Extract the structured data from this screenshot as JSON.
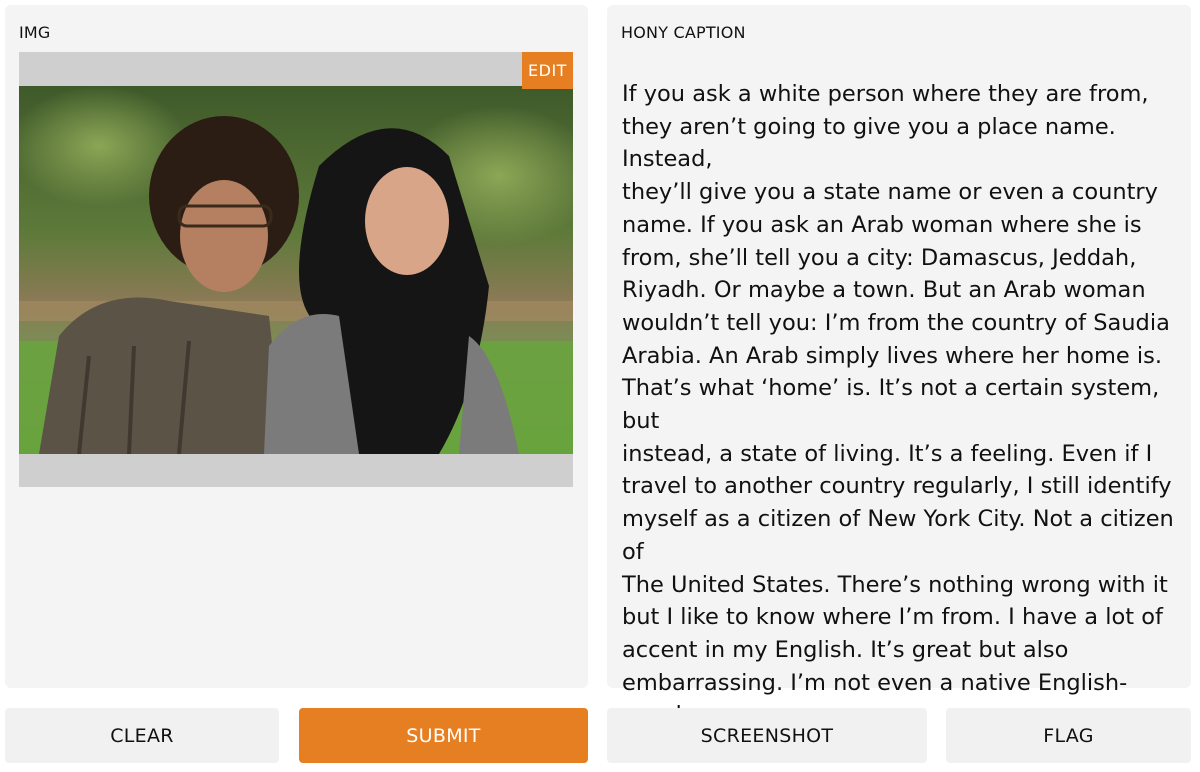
{
  "image_panel": {
    "label": "IMG",
    "edit_label": "EDIT"
  },
  "caption_panel": {
    "label": "HONY CAPTION",
    "text": "If you ask a white person where they are from,\nthey aren’t going to give you a place name. Instead,\nthey’ll give you a state name or even a country\nname. If you ask an Arab woman where she is\nfrom, she’ll tell you a city: Damascus, Jeddah,\nRiyadh. Or maybe a town. But an Arab woman\nwouldn’t tell you: I’m from the country of Saudia\nArabia. An Arab simply lives where her home is.\nThat’s what ‘home’ is. It’s not a certain system, but\ninstead, a state of living. It’s a feeling. Even if I\ntravel to another country regularly, I still identify\nmyself as a citizen of New York City. Not a citizen of\nThe United States. There’s nothing wrong with it\nbut I like to know where I’m from. I have a lot of\naccent in my English. It’s great but also\nembarrassing. I’m not even a native English-\nspeaker."
  },
  "buttons": {
    "clear": "CLEAR",
    "submit": "SUBMIT",
    "screenshot": "SCREENSHOT",
    "flag": "FLAG"
  },
  "colors": {
    "accent": "#e67e22",
    "panel_bg": "#f4f4f4",
    "image_frame": "#cfcfcf"
  }
}
